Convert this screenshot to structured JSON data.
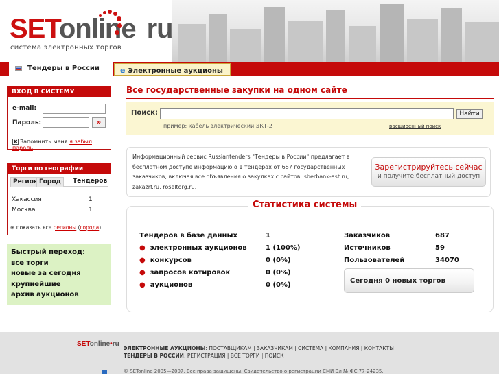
{
  "header": {
    "logo_set": "SET",
    "logo_online": "online",
    "logo_ru": "ru",
    "tagline": "система электронных торгов"
  },
  "tabs": [
    {
      "label": "Тендеры в России",
      "icon": "russia-flag-icon",
      "active": true
    },
    {
      "label": "Электронные аукционы",
      "icon": "ie-icon",
      "active": false
    }
  ],
  "login": {
    "title": "ВХОД В СИСТЕМУ",
    "email_label": "e-mail:",
    "password_label": "Пароль:",
    "go_label": "»",
    "remember_label": "Запомнить меня",
    "forgot_link": "я забыл пароль"
  },
  "geo": {
    "title": "Торги по географии",
    "tabs": [
      "Регион",
      "Город",
      "Тендеров"
    ],
    "rows": [
      {
        "name": "Хакассия",
        "count": "1"
      },
      {
        "name": "Москва",
        "count": "1"
      }
    ],
    "footer_prefix": "показать все",
    "footer_link1": "регионы",
    "footer_link2": "города"
  },
  "quick_nav": {
    "title": "Быстрый переход:",
    "items": [
      "все торги",
      "новые за сегодня",
      "крупнейшие",
      "архив аукционов"
    ]
  },
  "main": {
    "title": "Все государственные закупки на одном сайте",
    "search": {
      "label": "Поиск:",
      "value": "",
      "button": "Найти",
      "hint": "пример: кабель электрический ЭКТ-2",
      "advanced": "расширенный поиск"
    },
    "info": {
      "text": "Информационный сервис Russiantenders \"Тендеры в России\" предлагает в бесплатном доступе информацию о 1 тендерах от 687 государственных заказчиков, включая все объявления о закупках с сайтов: sberbank-ast.ru, zakazrf.ru, roseltorg.ru.",
      "register_line1": "Зарегистрируйтесь сейчас",
      "register_line2": "и получите бесплатный доступ"
    }
  },
  "stats": {
    "title": "Статистика системы",
    "left": [
      {
        "label": "Тендеров в базе данных",
        "value": "1",
        "bullet": false
      },
      {
        "label": "электронных аукционов",
        "value": "1 (100%)",
        "bullet": true
      },
      {
        "label": "конкурсов",
        "value": "0 (0%)",
        "bullet": true
      },
      {
        "label": "запросов котировок",
        "value": "0 (0%)",
        "bullet": true
      },
      {
        "label": "аукционов",
        "value": "0 (0%)",
        "bullet": true
      }
    ],
    "right": [
      {
        "label": "Заказчиков",
        "value": "687"
      },
      {
        "label": "Источников",
        "value": "59"
      },
      {
        "label": "Пользователей",
        "value": "34070"
      }
    ],
    "today": "Сегодня 0 новых торгов"
  },
  "footer": {
    "logo_set": "SET",
    "logo_online": "online",
    "logo_ru": "ru",
    "line1_head": "ЭЛЕКТРОННЫЕ АУКЦИОНЫ",
    "line1_rest": ": ПОСТАВЩИКАМ | ЗАКАЗЧИКАМ | СИСТЕМА | КОМПАНИЯ | КОНТАКТЫ",
    "line2_head": "ТЕНДЕРЫ В РОССИИ",
    "line2_rest": ": РЕГИСТРАЦИЯ | ВСЕ ТОРГИ | ПОИСК",
    "copyright": "© SETonline 2005—2007. Все права защищены. Свидетельство о регистрации СМИ Эл № ФС 77-24235."
  },
  "colors": {
    "brand_red": "#c50a0a",
    "search_bg": "#fbf6d2",
    "quick_bg": "#dcf2c4"
  }
}
